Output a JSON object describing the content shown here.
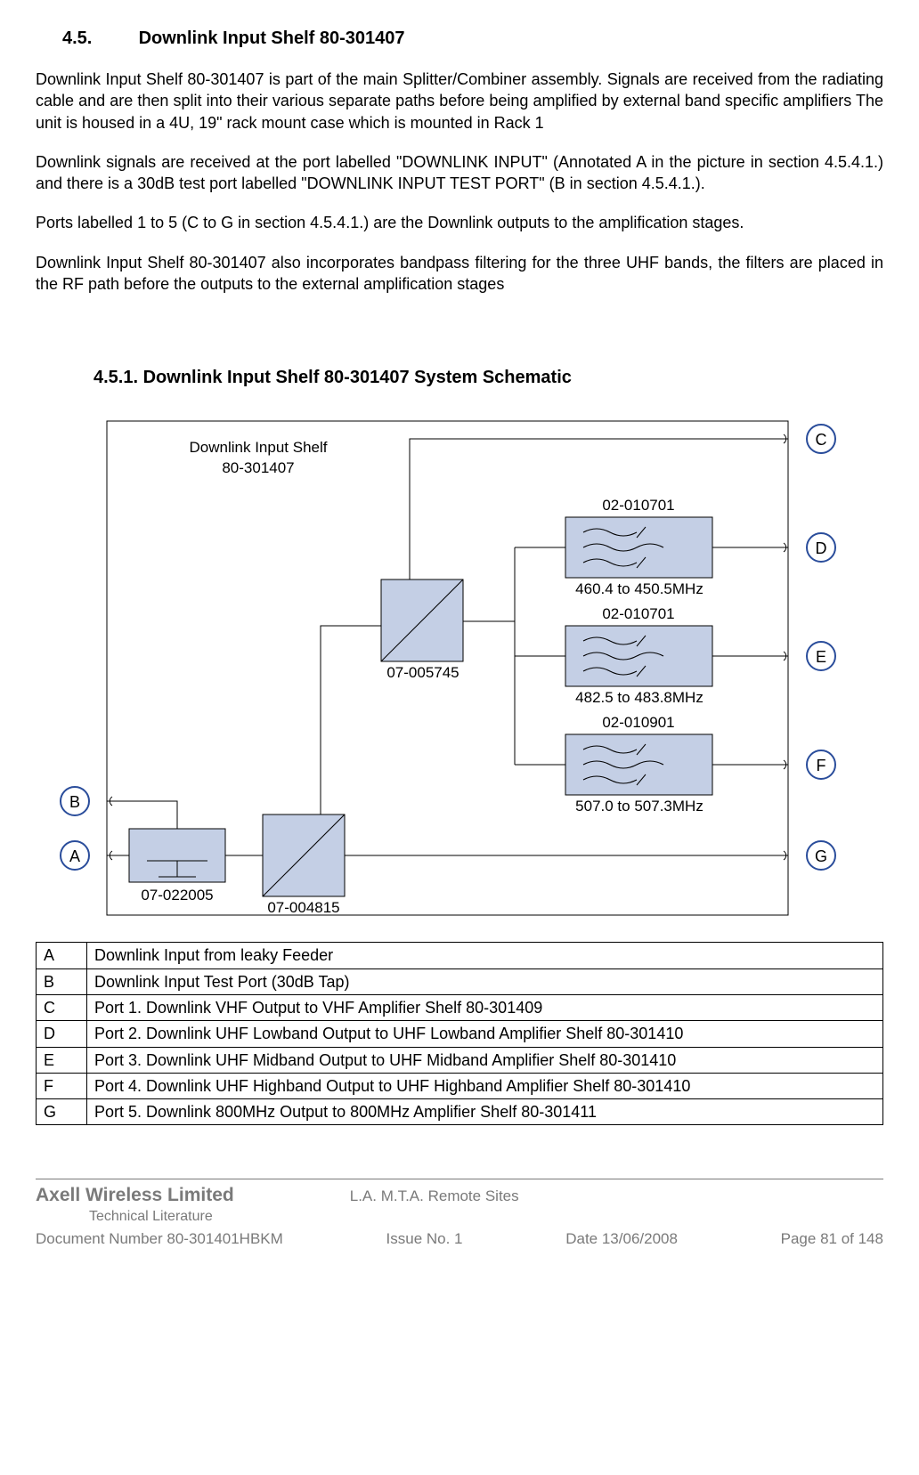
{
  "section": {
    "number": "4.5.",
    "title": "Downlink Input Shelf 80-301407"
  },
  "paragraphs": {
    "p1": "Downlink Input Shelf 80-301407 is part of the main Splitter/Combiner assembly. Signals are received from the radiating cable and are then split into their various separate paths before being amplified by external band specific amplifiers The unit is housed in a 4U, 19\" rack mount case which is mounted in Rack 1",
    "p2": "Downlink signals are received at the port labelled \"DOWNLINK INPUT\" (Annotated A in the picture in section 4.5.4.1.) and there is a 30dB test port labelled \"DOWNLINK INPUT TEST PORT\" (B in section 4.5.4.1.).",
    "p3": "Ports labelled 1 to 5 (C to G in section 4.5.4.1.) are the Downlink outputs to the amplification stages.",
    "p4": "Downlink Input Shelf 80-301407 also incorporates bandpass filtering for the three UHF bands, the filters are placed in the RF path before the outputs to the external amplification stages"
  },
  "subsection": {
    "heading": "4.5.1. Downlink Input Shelf 80-301407 System Schematic"
  },
  "schematic": {
    "title_line1": "Downlink Input Shelf",
    "title_line2": "80-301407",
    "splitters": {
      "sp1": "07-005745",
      "sp2": "07-004815"
    },
    "tap": "07-022005",
    "filters": {
      "f1": {
        "part": "02-010701",
        "band": "460.4 to 450.5MHz"
      },
      "f2": {
        "part": "02-010701",
        "band": "482.5 to 483.8MHz"
      },
      "f3": {
        "part": "02-010901",
        "band": "507.0 to 507.3MHz"
      }
    },
    "callouts": {
      "A": "A",
      "B": "B",
      "C": "C",
      "D": "D",
      "E": "E",
      "F": "F",
      "G": "G"
    }
  },
  "legend": [
    {
      "key": "A",
      "desc": "Downlink Input from leaky Feeder"
    },
    {
      "key": "B",
      "desc": "Downlink Input Test Port (30dB Tap)"
    },
    {
      "key": "C",
      "desc": "Port 1. Downlink VHF Output to VHF Amplifier Shelf 80-301409"
    },
    {
      "key": "D",
      "desc": "Port 2. Downlink UHF Lowband Output to UHF Lowband Amplifier Shelf 80-301410"
    },
    {
      "key": "E",
      "desc": "Port 3. Downlink UHF Midband Output to UHF Midband Amplifier Shelf 80-301410"
    },
    {
      "key": "F",
      "desc": "Port 4. Downlink UHF Highband Output to UHF Highband Amplifier Shelf 80-301410"
    },
    {
      "key": "G",
      "desc": "Port 5. Downlink 800MHz Output to 800MHz Amplifier Shelf 80-301411"
    }
  ],
  "footer": {
    "company": "Axell Wireless Limited",
    "subtitle": "Technical Literature",
    "project": "L.A. M.T.A. Remote Sites",
    "docnum": "Document Number 80-301401HBKM",
    "issue": "Issue No. 1",
    "date": "Date 13/06/2008",
    "page": "Page 81 of 148"
  }
}
